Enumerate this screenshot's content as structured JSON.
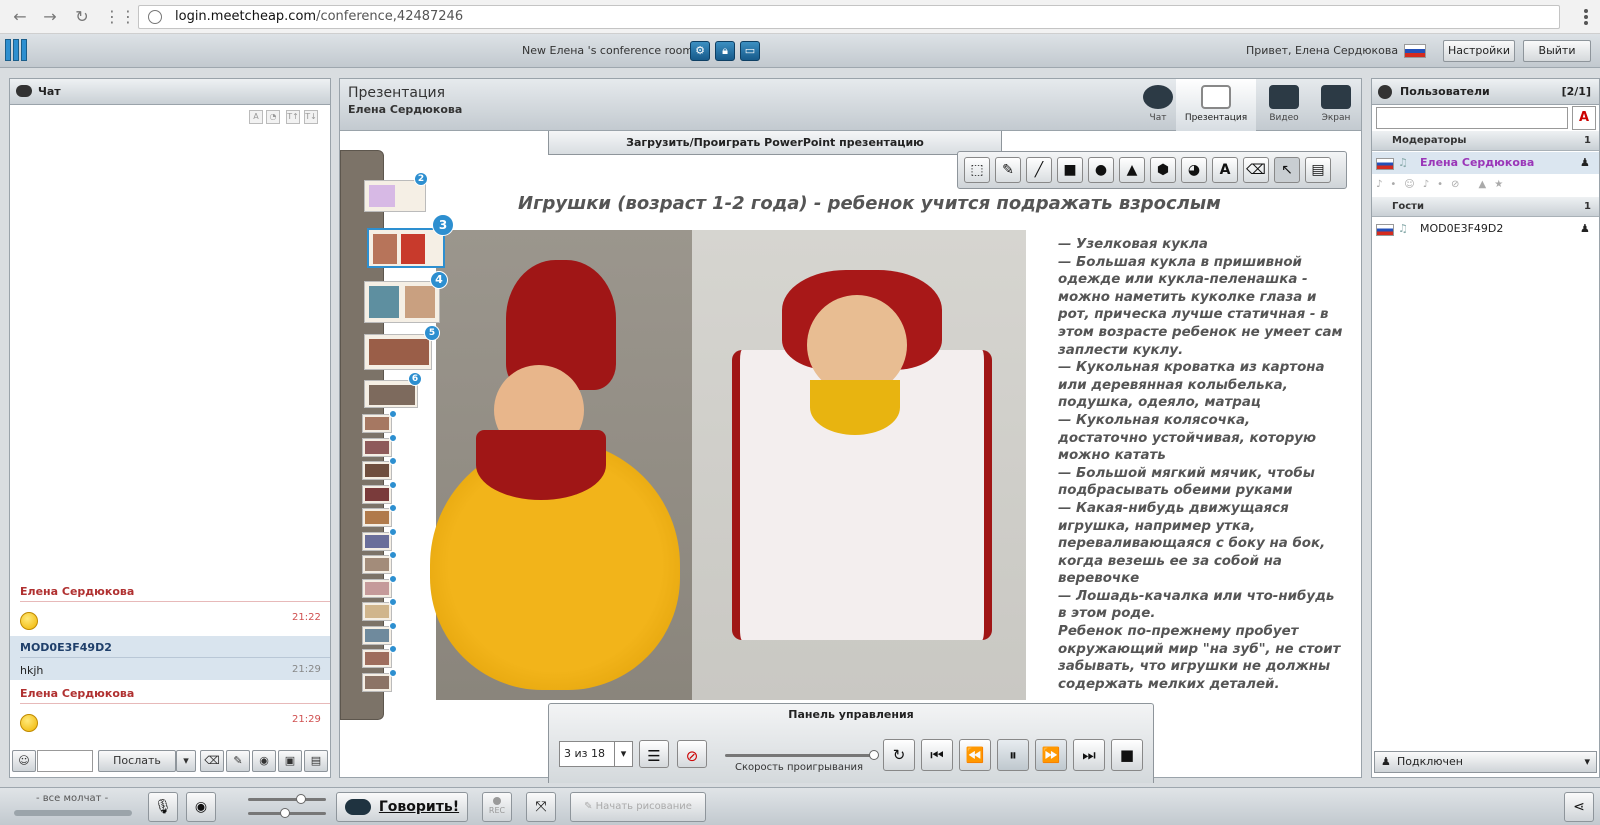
{
  "browser": {
    "url_host": "login.meetcheap.com",
    "url_path": "/conference,42487246"
  },
  "header": {
    "room_name": "New Елена 's conference room",
    "greeting": "Привет, Елена Сердюкова",
    "settings_label": "Настройки",
    "logout_label": "Выйти"
  },
  "chat": {
    "title": "Чат",
    "messages": [
      {
        "author": "Елена Сердюкова",
        "text": "",
        "time": "21:22"
      },
      {
        "author": "MOD0E3F49D2",
        "text": "hkjh",
        "time": "21:29"
      },
      {
        "author": "Елена Сердюкова",
        "text": "",
        "time": "21:29"
      }
    ],
    "send_label": "Послать",
    "input_value": ""
  },
  "presentation": {
    "title": "Презентация",
    "presenter": "Елена Сердюкова",
    "modes": [
      "Чат",
      "Презентация",
      "Видео",
      "Экран"
    ],
    "upload_label": "Загрузить/Проиграть PowerPoint презентацию",
    "slide_title": "Игрушки (возраст 1-2 года) - ребенок учится подражать взрослым",
    "slide_text": "— Узелковая кукла\n— Большая кукла в пришивной одежде или кукла-пеленашка - можно наметить куколке глаза и рот, прическа лучше статичная - в этом возрасте ребенок не умеет сам заплести куклу.\n— Кукольная кроватка из картона или деревянная колыбелька, подушка, одеяло, матрац\n— Кукольная колясочка, достаточно устойчивая, которую можно катать\n— Большой мягкий мячик, чтобы подбрасывать обеими руками\n— Какая-нибудь движущаяся игрушка, например утка, переваливающаяся с боку на бок, когда везешь ее за собой на веревочке\n— Лошадь-качалка или что-нибудь в этом роде.\nРебенок по-прежнему пробует окружающий мир \"на зуб\", не стоит забывать, что игрушки не должны содержать мелких деталей.",
    "thumb_badges": [
      "2",
      "3",
      "4",
      "5",
      "6"
    ]
  },
  "control": {
    "title": "Панель управления",
    "page_select": "3 из 18",
    "speed_label": "Скорость проигрывания"
  },
  "users": {
    "title": "Пользователи",
    "count": "[2/1]",
    "moderators_label": "Модераторы",
    "moderators_count": "1",
    "moderator": "Елена Сердюкова",
    "guests_label": "Гости",
    "guests_count": "1",
    "guest": "MOD0E3F49D2",
    "status": "Подключен"
  },
  "bottom": {
    "silence_label": "- все молчат -",
    "speak_label": "Говорить!",
    "rec_label": "REC",
    "draw_label": "Начать рисование"
  }
}
